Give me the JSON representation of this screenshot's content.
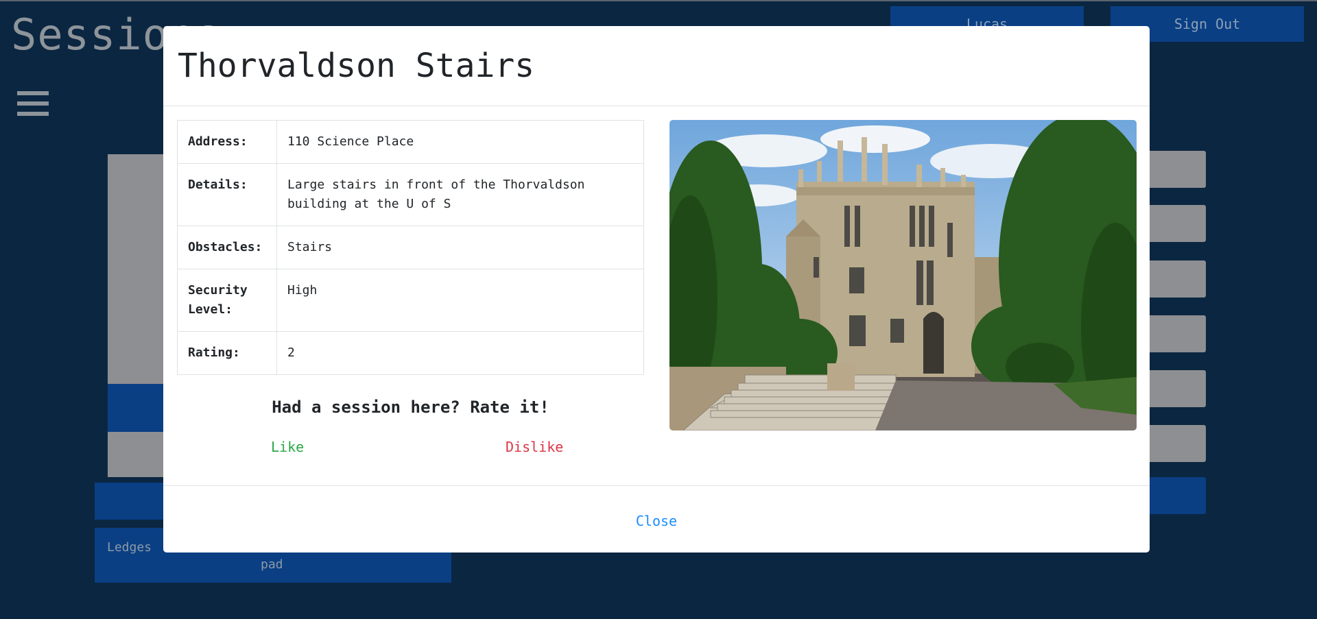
{
  "background": {
    "page_title": "Sessions",
    "user_button": "Lucas",
    "signout_button": "Sign Out",
    "ledges_label": "Ledges",
    "pad_label": "pad"
  },
  "modal": {
    "title": "Thorvaldson Stairs",
    "rows": [
      {
        "key": "Address:",
        "value": "110 Science Place"
      },
      {
        "key": "Details:",
        "value": "Large stairs in front of the Thorvaldson building at the U of S"
      },
      {
        "key": "Obstacles:",
        "value": "Stairs"
      },
      {
        "key": "Security Level:",
        "value": "High"
      },
      {
        "key": "Rating:",
        "value": "2"
      }
    ],
    "rate_prompt": "Had a session here? Rate it!",
    "like_label": "Like",
    "dislike_label": "Dislike",
    "close_label": "Close"
  },
  "colors": {
    "background": "#0b2641",
    "primary_blue": "#0a3f84",
    "like": "#28a745",
    "dislike": "#dc3545",
    "close_link": "#1a8cff"
  }
}
